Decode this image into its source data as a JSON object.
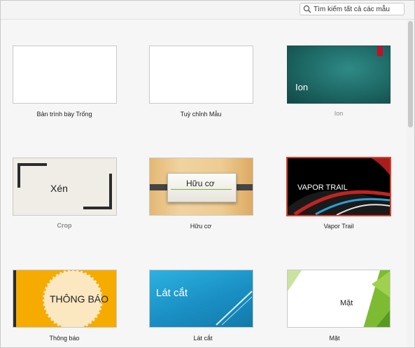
{
  "search": {
    "placeholder": "Tìm kiếm tất cả các mẫu"
  },
  "templates": {
    "blank": {
      "caption": "Bản trình bày Trống"
    },
    "custom": {
      "caption": "Tuỳ chỉnh Mẫu"
    },
    "ion": {
      "caption": "Ion",
      "thumb_text": "Ion"
    },
    "crop": {
      "caption": "Crop",
      "thumb_text": "Xén"
    },
    "organic": {
      "caption": "Hữu cơ",
      "thumb_text": "Hữu cơ"
    },
    "vapor": {
      "caption": "Vapor Trail",
      "thumb_text": "VAPOR TRAIL"
    },
    "badge": {
      "caption": "Thông báo",
      "thumb_text": "THÔNG BÁO"
    },
    "slice": {
      "caption": "Lát cắt",
      "thumb_text": "Lát cắt"
    },
    "facet": {
      "caption": "Mặt",
      "thumb_text": "Mặt"
    }
  },
  "colors": {
    "ion_bg": "#1f6a6a",
    "ion_accent": "#c0102a",
    "vapor_border": "#d8402a",
    "badge_bg": "#f5ab00",
    "slice_bg": "#1a8fc4",
    "facet_green": "#7dbb33"
  }
}
